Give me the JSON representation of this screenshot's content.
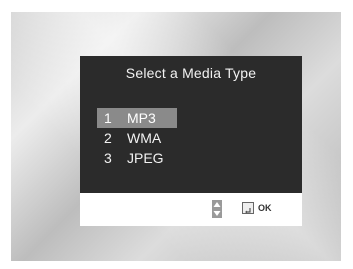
{
  "dialog": {
    "title": "Select a Media Type",
    "items": [
      {
        "num": "1",
        "label": "MP3",
        "selected": true
      },
      {
        "num": "2",
        "label": "WMA",
        "selected": false
      },
      {
        "num": "3",
        "label": "JPEG",
        "selected": false
      }
    ]
  },
  "footer": {
    "ok_label": "OK",
    "icons": [
      "up-down-arrows-icon",
      "enter-icon"
    ]
  },
  "colors": {
    "dialog_bg": "#2b2b2b",
    "selection": "#8a8a8a",
    "text": "#f2f2f2"
  }
}
